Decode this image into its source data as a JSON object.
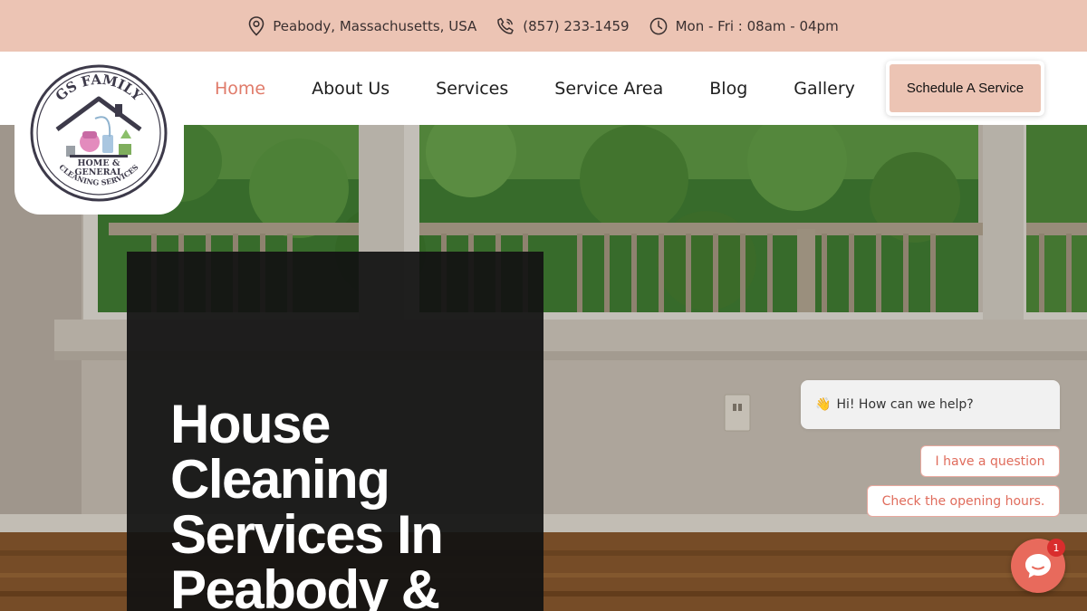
{
  "topbar": {
    "location": "Peabody, Massachusetts, USA",
    "phone": "(857) 233-1459",
    "hours": "Mon - Fri : 08am - 04pm",
    "icons": [
      "map-pin-icon",
      "phone-icon",
      "clock-icon"
    ]
  },
  "logo": {
    "line1": "GS FAMILY",
    "line2": "HOME &",
    "line3": "GENERAL",
    "line4": "CLEANING SERVICES"
  },
  "nav": {
    "items": [
      {
        "label": "Home",
        "active": true
      },
      {
        "label": "About Us",
        "active": false
      },
      {
        "label": "Services",
        "active": false
      },
      {
        "label": "Service Area",
        "active": false
      },
      {
        "label": "Blog",
        "active": false
      },
      {
        "label": "Gallery",
        "active": false
      }
    ],
    "cta_label": "Schedule A Service"
  },
  "hero": {
    "title": "House Cleaning Services In Peabody &"
  },
  "chat": {
    "greeting_emoji": "👋",
    "greeting": "Hi! How can we help?",
    "options": [
      "I have a question",
      "Check the opening hours."
    ],
    "unread_count": "1",
    "launcher_icon": "chat-icon"
  },
  "colors": {
    "topbar_bg": "#ecc4b4",
    "accent": "#e07b6a",
    "chat_accent": "#e86a5c",
    "hero_panel": "#121212"
  }
}
